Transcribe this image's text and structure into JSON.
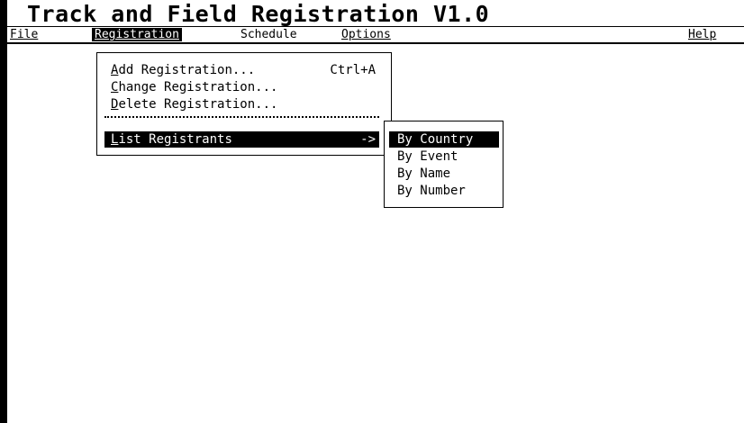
{
  "app": {
    "title": "Track and Field Registration V1.0"
  },
  "menubar": {
    "file": "File",
    "registration": "Registration",
    "schedule": "Schedule",
    "options": "Options",
    "help": "Help"
  },
  "registration_menu": {
    "add": {
      "label": "Add Registration...",
      "mnemonic": "A",
      "shortcut": "Ctrl+A"
    },
    "change": {
      "label": "Change Registration...",
      "mnemonic": "C"
    },
    "delete": {
      "label": "Delete Registration...",
      "mnemonic": "D"
    },
    "list": {
      "label": "List Registrants",
      "mnemonic": "L",
      "submenu_arrow": "->"
    }
  },
  "list_submenu": {
    "items": [
      "By Country",
      "By Event",
      "By Name",
      "By Number"
    ],
    "selected": "By Country"
  },
  "colors": {
    "background": "#ffffff",
    "foreground": "#000000",
    "highlight_bg": "#000000",
    "highlight_fg": "#ffffff"
  }
}
